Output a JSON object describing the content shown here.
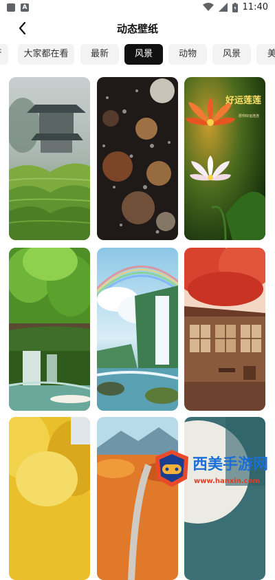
{
  "status_bar": {
    "time": "11:40",
    "left_icons": [
      "notification-square-icon",
      "a-badge-icon"
    ],
    "right_icons": [
      "wifi-icon",
      "signal-icon",
      "battery-icon"
    ]
  },
  "header": {
    "title": "动态壁纸",
    "back_icon": "chevron-left-icon"
  },
  "tabs": [
    {
      "label": "行",
      "active": false
    },
    {
      "label": "大家都在看",
      "active": false
    },
    {
      "label": "最新",
      "active": false
    },
    {
      "label": "风景",
      "active": true
    },
    {
      "label": "动物",
      "active": false
    },
    {
      "label": "风景",
      "active": false
    },
    {
      "label": "美",
      "active": false
    }
  ],
  "wallpapers": [
    {
      "name": "misty-pavilion-tea-hills"
    },
    {
      "name": "rain-on-glass-bokeh"
    },
    {
      "name": "lotus-good-luck",
      "text_title": "好运莲莲",
      "text_small": "愿你好运连连"
    },
    {
      "name": "forest-waterfall-stream"
    },
    {
      "name": "rainbow-waterfall"
    },
    {
      "name": "red-maple-house"
    },
    {
      "name": "golden-trees"
    },
    {
      "name": "autumn-mountain-road"
    },
    {
      "name": "teal-moon-sky"
    }
  ],
  "watermark": {
    "text": "西美手游网",
    "url": "www.hanxin.com"
  },
  "colors": {
    "active_tab_bg": "#111111",
    "tab_bg": "#f3f3f3",
    "watermark_blue": "#1a6fd6"
  }
}
